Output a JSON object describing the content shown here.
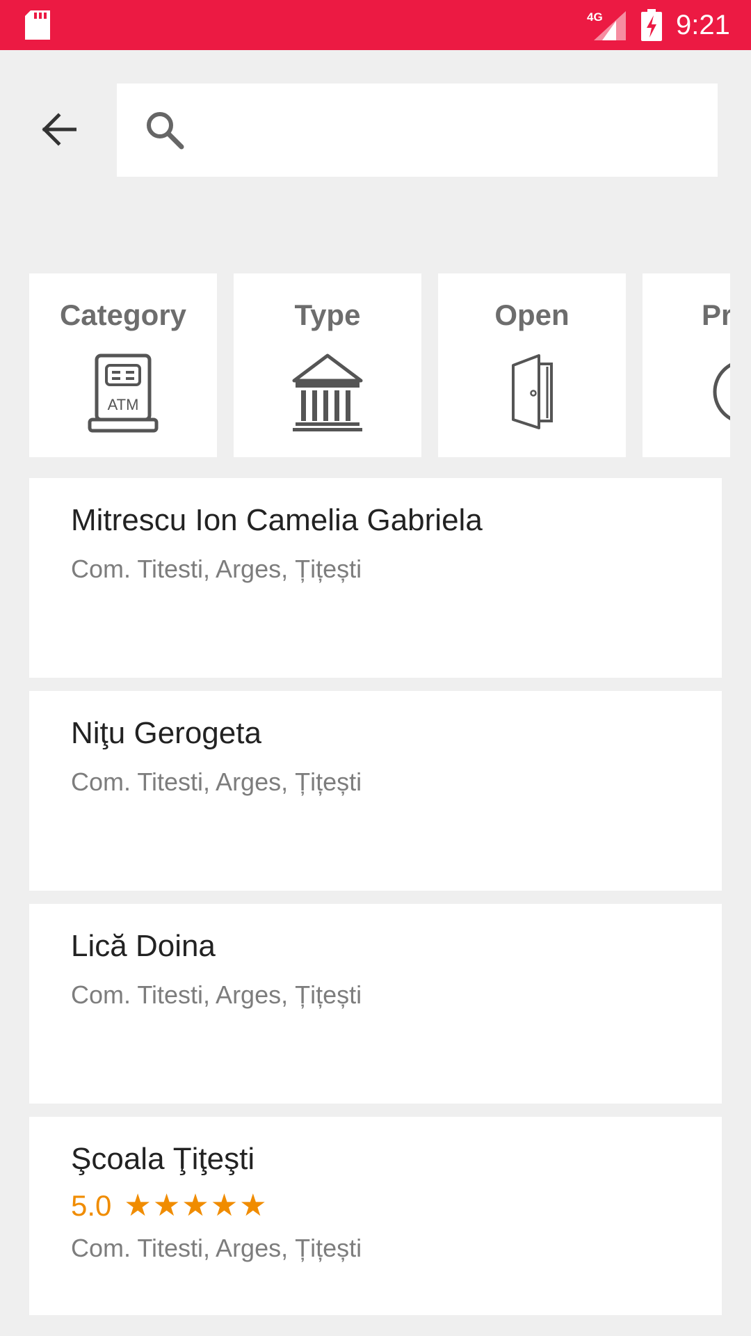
{
  "status_bar": {
    "network": "4G",
    "time": "9:21",
    "color": "#ec1a43"
  },
  "search": {
    "placeholder": "",
    "value": ""
  },
  "filters": [
    {
      "label": "Category",
      "icon": "atm-icon"
    },
    {
      "label": "Type",
      "icon": "bank-building-icon"
    },
    {
      "label": "Open",
      "icon": "door-icon"
    },
    {
      "label": "Pr",
      "icon": "navigation-icon"
    }
  ],
  "results": [
    {
      "name": "Mitrescu Ion Camelia Gabriela",
      "address": "Com. Titesti, Arges, Țițești"
    },
    {
      "name": "Niţu Gerogeta",
      "address": "Com. Titesti, Arges, Țițești"
    },
    {
      "name": "Lică Doina",
      "address": "Com. Titesti, Arges, Țițești"
    },
    {
      "name": "Şcoala Ţiţeşti",
      "rating": "5.0",
      "stars": "★★★★★",
      "rating_fraction": 1.0,
      "address": "Com. Titesti, Arges, Țițești"
    }
  ],
  "accent_colors": {
    "rating": "#f08c00",
    "icon_gray": "#555555"
  }
}
